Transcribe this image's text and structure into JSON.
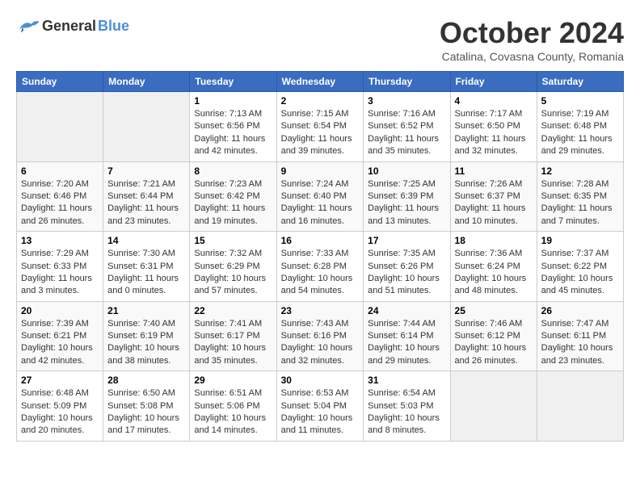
{
  "header": {
    "logo_general": "General",
    "logo_blue": "Blue",
    "title": "October 2024",
    "subtitle": "Catalina, Covasna County, Romania"
  },
  "days_of_week": [
    "Sunday",
    "Monday",
    "Tuesday",
    "Wednesday",
    "Thursday",
    "Friday",
    "Saturday"
  ],
  "weeks": [
    [
      {
        "day": "",
        "info": ""
      },
      {
        "day": "",
        "info": ""
      },
      {
        "day": "1",
        "info": "Sunrise: 7:13 AM\nSunset: 6:56 PM\nDaylight: 11 hours and 42 minutes."
      },
      {
        "day": "2",
        "info": "Sunrise: 7:15 AM\nSunset: 6:54 PM\nDaylight: 11 hours and 39 minutes."
      },
      {
        "day": "3",
        "info": "Sunrise: 7:16 AM\nSunset: 6:52 PM\nDaylight: 11 hours and 35 minutes."
      },
      {
        "day": "4",
        "info": "Sunrise: 7:17 AM\nSunset: 6:50 PM\nDaylight: 11 hours and 32 minutes."
      },
      {
        "day": "5",
        "info": "Sunrise: 7:19 AM\nSunset: 6:48 PM\nDaylight: 11 hours and 29 minutes."
      }
    ],
    [
      {
        "day": "6",
        "info": "Sunrise: 7:20 AM\nSunset: 6:46 PM\nDaylight: 11 hours and 26 minutes."
      },
      {
        "day": "7",
        "info": "Sunrise: 7:21 AM\nSunset: 6:44 PM\nDaylight: 11 hours and 23 minutes."
      },
      {
        "day": "8",
        "info": "Sunrise: 7:23 AM\nSunset: 6:42 PM\nDaylight: 11 hours and 19 minutes."
      },
      {
        "day": "9",
        "info": "Sunrise: 7:24 AM\nSunset: 6:40 PM\nDaylight: 11 hours and 16 minutes."
      },
      {
        "day": "10",
        "info": "Sunrise: 7:25 AM\nSunset: 6:39 PM\nDaylight: 11 hours and 13 minutes."
      },
      {
        "day": "11",
        "info": "Sunrise: 7:26 AM\nSunset: 6:37 PM\nDaylight: 11 hours and 10 minutes."
      },
      {
        "day": "12",
        "info": "Sunrise: 7:28 AM\nSunset: 6:35 PM\nDaylight: 11 hours and 7 minutes."
      }
    ],
    [
      {
        "day": "13",
        "info": "Sunrise: 7:29 AM\nSunset: 6:33 PM\nDaylight: 11 hours and 3 minutes."
      },
      {
        "day": "14",
        "info": "Sunrise: 7:30 AM\nSunset: 6:31 PM\nDaylight: 11 hours and 0 minutes."
      },
      {
        "day": "15",
        "info": "Sunrise: 7:32 AM\nSunset: 6:29 PM\nDaylight: 10 hours and 57 minutes."
      },
      {
        "day": "16",
        "info": "Sunrise: 7:33 AM\nSunset: 6:28 PM\nDaylight: 10 hours and 54 minutes."
      },
      {
        "day": "17",
        "info": "Sunrise: 7:35 AM\nSunset: 6:26 PM\nDaylight: 10 hours and 51 minutes."
      },
      {
        "day": "18",
        "info": "Sunrise: 7:36 AM\nSunset: 6:24 PM\nDaylight: 10 hours and 48 minutes."
      },
      {
        "day": "19",
        "info": "Sunrise: 7:37 AM\nSunset: 6:22 PM\nDaylight: 10 hours and 45 minutes."
      }
    ],
    [
      {
        "day": "20",
        "info": "Sunrise: 7:39 AM\nSunset: 6:21 PM\nDaylight: 10 hours and 42 minutes."
      },
      {
        "day": "21",
        "info": "Sunrise: 7:40 AM\nSunset: 6:19 PM\nDaylight: 10 hours and 38 minutes."
      },
      {
        "day": "22",
        "info": "Sunrise: 7:41 AM\nSunset: 6:17 PM\nDaylight: 10 hours and 35 minutes."
      },
      {
        "day": "23",
        "info": "Sunrise: 7:43 AM\nSunset: 6:16 PM\nDaylight: 10 hours and 32 minutes."
      },
      {
        "day": "24",
        "info": "Sunrise: 7:44 AM\nSunset: 6:14 PM\nDaylight: 10 hours and 29 minutes."
      },
      {
        "day": "25",
        "info": "Sunrise: 7:46 AM\nSunset: 6:12 PM\nDaylight: 10 hours and 26 minutes."
      },
      {
        "day": "26",
        "info": "Sunrise: 7:47 AM\nSunset: 6:11 PM\nDaylight: 10 hours and 23 minutes."
      }
    ],
    [
      {
        "day": "27",
        "info": "Sunrise: 6:48 AM\nSunset: 5:09 PM\nDaylight: 10 hours and 20 minutes."
      },
      {
        "day": "28",
        "info": "Sunrise: 6:50 AM\nSunset: 5:08 PM\nDaylight: 10 hours and 17 minutes."
      },
      {
        "day": "29",
        "info": "Sunrise: 6:51 AM\nSunset: 5:06 PM\nDaylight: 10 hours and 14 minutes."
      },
      {
        "day": "30",
        "info": "Sunrise: 6:53 AM\nSunset: 5:04 PM\nDaylight: 10 hours and 11 minutes."
      },
      {
        "day": "31",
        "info": "Sunrise: 6:54 AM\nSunset: 5:03 PM\nDaylight: 10 hours and 8 minutes."
      },
      {
        "day": "",
        "info": ""
      },
      {
        "day": "",
        "info": ""
      }
    ]
  ]
}
